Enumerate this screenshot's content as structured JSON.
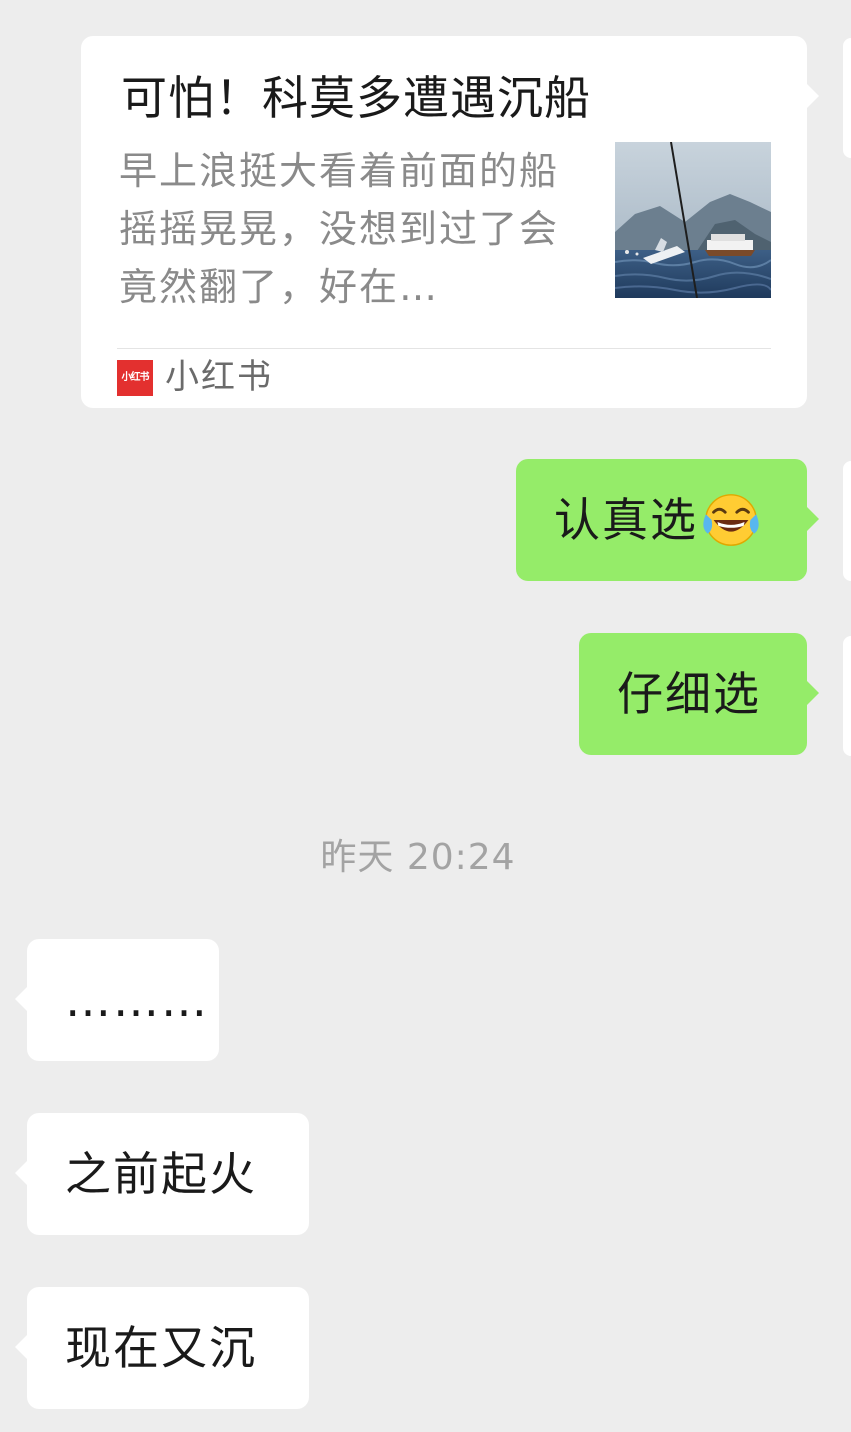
{
  "link_card": {
    "title": "可怕！科莫多遭遇沉船",
    "description": "早上浪挺大看着前面的船摇摇晃晃，没想到过了会竟然翻了，好在…",
    "source_logo_text": "小红书",
    "source_name": "小红书",
    "thumbnail_icon": "capsized-boat-photo"
  },
  "messages": [
    {
      "direction": "out",
      "text": "认真选",
      "emoji": "face-with-tears-of-joy"
    },
    {
      "direction": "out",
      "text": "仔细选"
    },
    {
      "direction": "in",
      "text": "………"
    },
    {
      "direction": "in",
      "text": "之前起火"
    },
    {
      "direction": "in",
      "text": "现在又沉"
    }
  ],
  "timestamp": "昨天 20:24",
  "colors": {
    "background": "#ededed",
    "outgoing_bubble": "#95ec69",
    "incoming_bubble": "#ffffff",
    "source_logo": "#e3302f",
    "timestamp_text": "#a3a3a3"
  }
}
